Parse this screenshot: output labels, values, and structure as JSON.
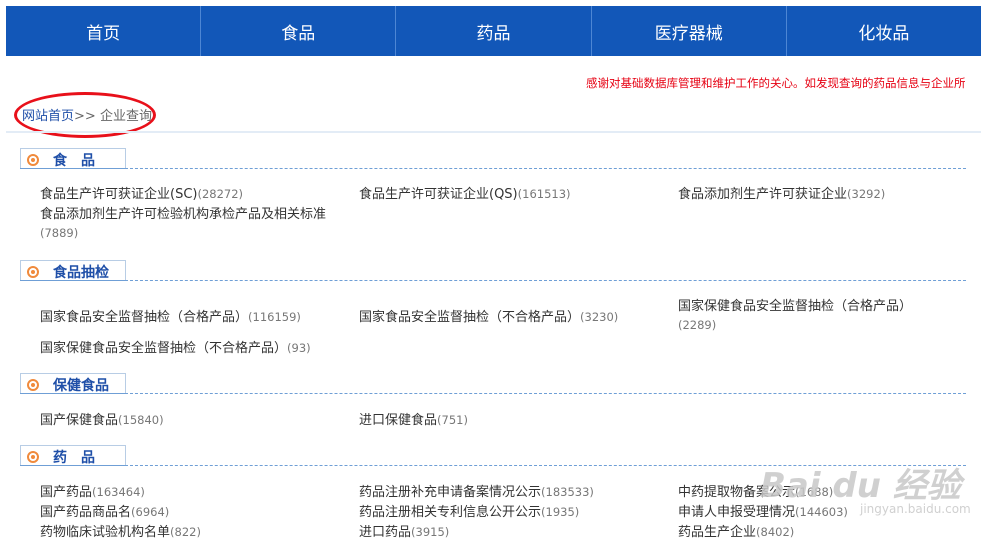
{
  "nav": [
    "首页",
    "食品",
    "药品",
    "医疗器械",
    "化妆品"
  ],
  "notice": "感谢对基础数据库管理和维护工作的关心。如发现查询的药品信息与企业所",
  "breadcrumb": {
    "home": "网站首页",
    "sep": ">>",
    "current": "企业查询"
  },
  "sections": [
    {
      "title": "食　品",
      "items": [
        {
          "label": "食品生产许可获证企业(SC)",
          "count": "(28272)"
        },
        {
          "label": "食品生产许可获证企业(QS)",
          "count": "(161513)"
        },
        {
          "label": "食品添加剂生产许可获证企业",
          "count": "(3292)"
        },
        {
          "label": "食品添加剂生产许可检验机构承检产品及相关标准",
          "count": "(7889)"
        }
      ]
    },
    {
      "title": "食品抽检",
      "items": [
        {
          "label": "国家食品安全监督抽检（合格产品）",
          "count": "(116159)"
        },
        {
          "label": "国家食品安全监督抽检（不合格产品）",
          "count": "(3230)"
        },
        {
          "label": "国家保健食品安全监督抽检（合格产品）",
          "count": "(2289)"
        },
        {
          "label": "国家保健食品安全监督抽检（不合格产品）",
          "count": "(93)"
        }
      ]
    },
    {
      "title": "保健食品",
      "items": [
        {
          "label": "国产保健食品",
          "count": "(15840)"
        },
        {
          "label": "进口保健食品",
          "count": "(751)"
        }
      ]
    },
    {
      "title": "药　品",
      "items": [
        {
          "label": "国产药品",
          "count": "(163464)"
        },
        {
          "label": "药品注册补充申请备案情况公示",
          "count": "(183533)"
        },
        {
          "label": "中药提取物备案公示",
          "count": "(1688)"
        },
        {
          "label": "国产药品商品名",
          "count": "(6964)"
        },
        {
          "label": "药品注册相关专利信息公开公示",
          "count": "(1935)"
        },
        {
          "label": "申请人申报受理情况",
          "count": "(144603)"
        },
        {
          "label": "药物临床试验机构名单",
          "count": "(822)"
        },
        {
          "label": "进口药品",
          "count": "(3915)"
        },
        {
          "label": "药品生产企业",
          "count": "(8402)"
        }
      ]
    }
  ],
  "watermark": {
    "text": "Bai du 经验",
    "sub": "jingyan.baidu.com"
  }
}
